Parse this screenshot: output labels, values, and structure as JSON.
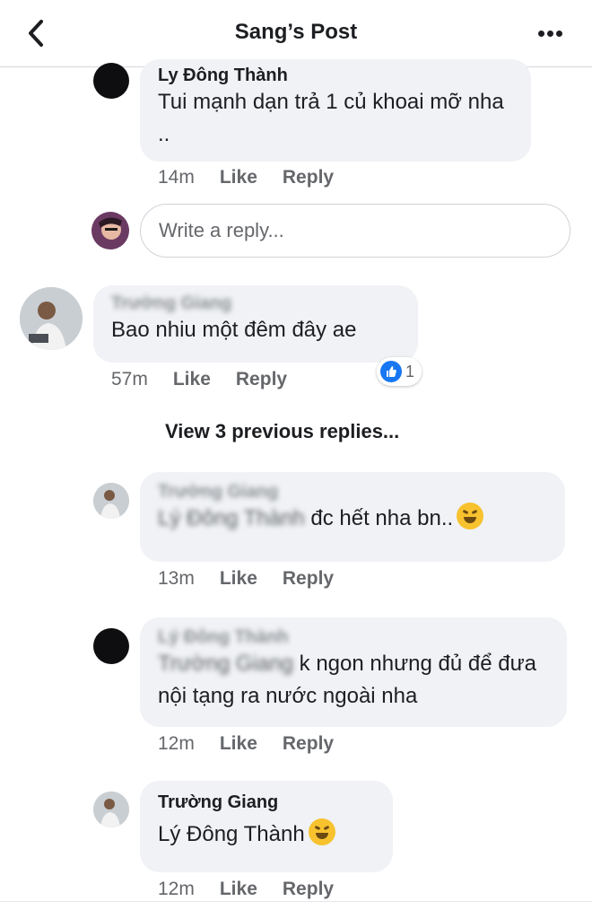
{
  "header": {
    "title": "Sang’s Post",
    "back_icon": "chevron-left-icon",
    "more_icon": "more-dots-icon"
  },
  "comments": [
    {
      "author": "Ly Đông Thành",
      "text": "Tui mạnh dạn trả 1 củ khoai mỡ nha ..",
      "time": "14m",
      "like": "Like",
      "reply": "Reply"
    },
    {
      "author": "Trường Giang",
      "text": "Bao nhiu một đêm đây ae",
      "time": "57m",
      "like": "Like",
      "reply": "Reply",
      "reaction_count": "1"
    },
    {
      "author": "Trường Giang",
      "mention": "Lý Đông Thành",
      "text": "đc hết nha bn..",
      "time": "13m",
      "like": "Like",
      "reply": "Reply"
    },
    {
      "author": "Lý Đông Thành",
      "mention": "Trường Giang",
      "text": "k ngon nhưng đủ để đưa nội tạng ra nước ngoài nha",
      "time": "12m",
      "like": "Like",
      "reply": "Reply"
    },
    {
      "author": "Trường Giang",
      "text": "Lý Đông Thành",
      "time": "12m",
      "like": "Like",
      "reply": "Reply"
    }
  ],
  "reply_input": {
    "placeholder": "Write a reply..."
  },
  "view_previous": "View 3 previous replies...",
  "colors": {
    "bubble": "#f0f2f5",
    "like_blue": "#1877f2",
    "meta_gray": "#65676b"
  }
}
